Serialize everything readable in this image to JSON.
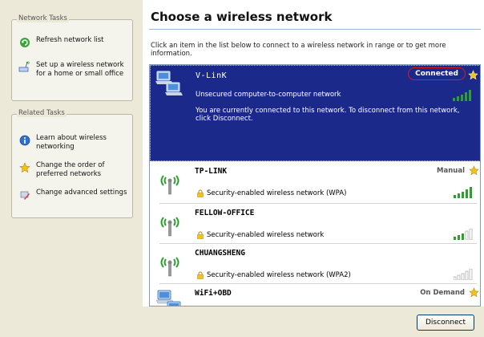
{
  "left_pane": {
    "network_tasks": {
      "title": "Network Tasks",
      "items": [
        {
          "label": "Refresh network list"
        },
        {
          "label": "Set up a wireless network for a home or small office"
        }
      ]
    },
    "related_tasks": {
      "title": "Related Tasks",
      "items": [
        {
          "label": "Learn about wireless networking"
        },
        {
          "label": "Change the order of preferred networks"
        },
        {
          "label": "Change advanced settings"
        }
      ]
    }
  },
  "main": {
    "title": "Choose a wireless network",
    "instruction": "Click an item in the list below to connect to a wireless network in range or to get more information.",
    "networks": [
      {
        "name": "V-LinK",
        "security": "Unsecured computer-to-computer network",
        "status": "Connected",
        "description": "You are currently connected to this network. To disconnect from this network, click Disconnect.",
        "signal_strength": 5,
        "selected": true
      },
      {
        "name": "TP-LINK",
        "security": "Security-enabled wireless network (WPA)",
        "status": "Manual",
        "signal_strength": 5
      },
      {
        "name": "FELLOW-OFFICE",
        "security": "Security-enabled wireless network",
        "status": "",
        "signal_strength": 3
      },
      {
        "name": "CHUANGSHENG",
        "security": "Security-enabled wireless network (WPA2)",
        "status": "",
        "signal_strength": 0
      },
      {
        "name": "WiFi+OBD",
        "security": "",
        "status": "On Demand",
        "signal_strength": 0
      }
    ],
    "disconnect_label": "Disconnect"
  },
  "colors": {
    "selection": "#1b2a8a",
    "signal_active": "#2ea02e",
    "signal_inactive": "#b0b0b0",
    "connected_outline": "#d81c1c",
    "star": "#f2c21a"
  }
}
